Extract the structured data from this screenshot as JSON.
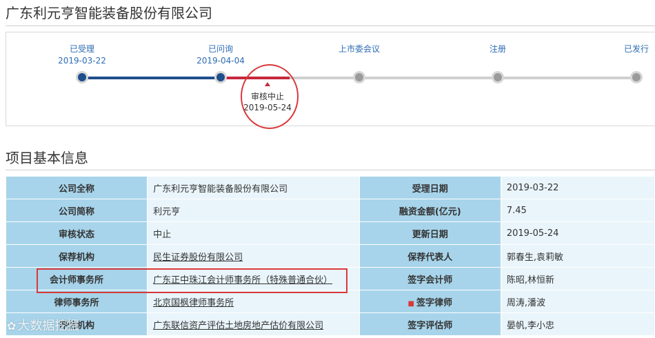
{
  "page": {
    "title": "广东利元亨智能装备股份有限公司"
  },
  "progress": {
    "stages": [
      {
        "label": "已受理",
        "date": "2019-03-22"
      },
      {
        "label": "已问询",
        "date": "2019-04-04"
      },
      {
        "label": "上市委会议",
        "date": ""
      },
      {
        "label": "注册",
        "date": ""
      },
      {
        "label": "已发行",
        "date": ""
      }
    ],
    "halt": {
      "label": "审核中止",
      "date": "2019-05-24"
    },
    "colors": {
      "done": "#1f4e8c",
      "halted": "#c5283d",
      "pending": "#cfcfcf",
      "dot_done": "#1f4e8c",
      "dot_pending": "#9b9b9b"
    }
  },
  "section": {
    "title": "项目基本信息"
  },
  "info_rows": [
    {
      "l1": "公司全称",
      "v1": "广东利元亨智能装备股份有限公司",
      "l2": "受理日期",
      "v2": "2019-03-22"
    },
    {
      "l1": "公司简称",
      "v1": "利元亨",
      "l2": "融资金额(亿元)",
      "v2": "7.45"
    },
    {
      "l1": "审核状态",
      "v1": "中止",
      "l2": "更新日期",
      "v2": "2019-05-24"
    },
    {
      "l1": "保荐机构",
      "v1": "民生证券股份有限公司",
      "l2": "保荐代表人",
      "v2": "郭春生,袁莉敏"
    },
    {
      "l1": "会计师事务所",
      "v1": "广东正中珠江会计师事务所（特殊普通合伙）",
      "l2": "签字会计师",
      "v2": "陈昭,林恒新"
    },
    {
      "l1": "律师事务所",
      "v1": "北京国枫律师事务所",
      "l2": "签字律师",
      "v2": "周涛,潘波"
    },
    {
      "l1": "评估机构",
      "v1": "广东联信资产评估土地房地产估价有限公司",
      "l2": "签字评估师",
      "v2": "晏帆,李小忠"
    }
  ],
  "watermark": {
    "text": "大数据挖掘"
  }
}
